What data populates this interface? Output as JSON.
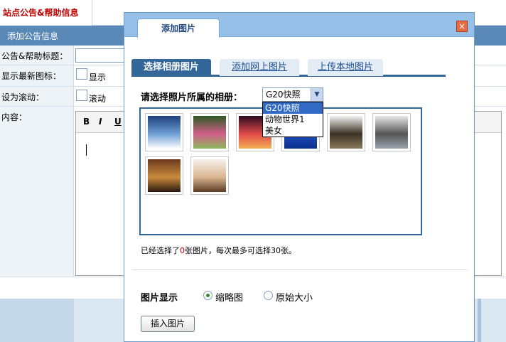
{
  "background": {
    "site_tab": "站点公告&帮助信息",
    "section_title": "添加公告信息",
    "rows": {
      "title_label": "公告&帮助标题：",
      "new_icon_label": "显示最新图标：",
      "new_icon_check": "显示",
      "scroll_label": "设为滚动：",
      "scroll_check": "滚动",
      "content_label": "内容："
    },
    "editor_toolbar": [
      "B",
      "I",
      "U"
    ]
  },
  "dialog": {
    "title": "添加图片",
    "close_glyph": "×",
    "tabs": [
      {
        "label": "选择相册图片",
        "active": true
      },
      {
        "label": "添加网上图片",
        "active": false
      },
      {
        "label": "上传本地图片",
        "active": false
      }
    ],
    "album_label": "请选择照片所属的相册：",
    "album_selected": "G20快照",
    "album_options": [
      "G20快照",
      "动物世界1",
      "美女"
    ],
    "photos": [
      {
        "name": "photo-waves",
        "colors": [
          "#1d3f7a",
          "#6f9fd4",
          "#ffffff"
        ]
      },
      {
        "name": "photo-lotus",
        "colors": [
          "#2b5a21",
          "#d35f8b",
          "#8bb75a"
        ]
      },
      {
        "name": "photo-sunset",
        "colors": [
          "#2a0b22",
          "#e14a4a",
          "#f4b054"
        ]
      },
      {
        "name": "photo-blue",
        "colors": [
          "#0b2e8a",
          "#1f4fbf",
          "#0b2e8a"
        ]
      },
      {
        "name": "photo-man-jacket",
        "colors": [
          "#f4f4f4",
          "#3b3124",
          "#8c7a5d"
        ]
      },
      {
        "name": "photo-group",
        "colors": [
          "#e8e8e8",
          "#555555",
          "#9aa3ad"
        ]
      },
      {
        "name": "photo-singer",
        "colors": [
          "#6b3a1d",
          "#c98a3d",
          "#2a1a10"
        ]
      },
      {
        "name": "photo-woman",
        "colors": [
          "#f7f2ec",
          "#d9b48f",
          "#5a3a24"
        ]
      }
    ],
    "count_text": {
      "prefix": "已经选择了",
      "count": "0",
      "suffix": "张图片，每次最多可选择30张。"
    },
    "display": {
      "label": "图片显示",
      "options": [
        {
          "label": "缩略图",
          "checked": true
        },
        {
          "label": "原始大小",
          "checked": false
        }
      ]
    },
    "insert_button": "插入图片"
  },
  "colors": {
    "accent": "#336699",
    "title_red": "#c00000",
    "dialog_head": "#96c0e8"
  }
}
